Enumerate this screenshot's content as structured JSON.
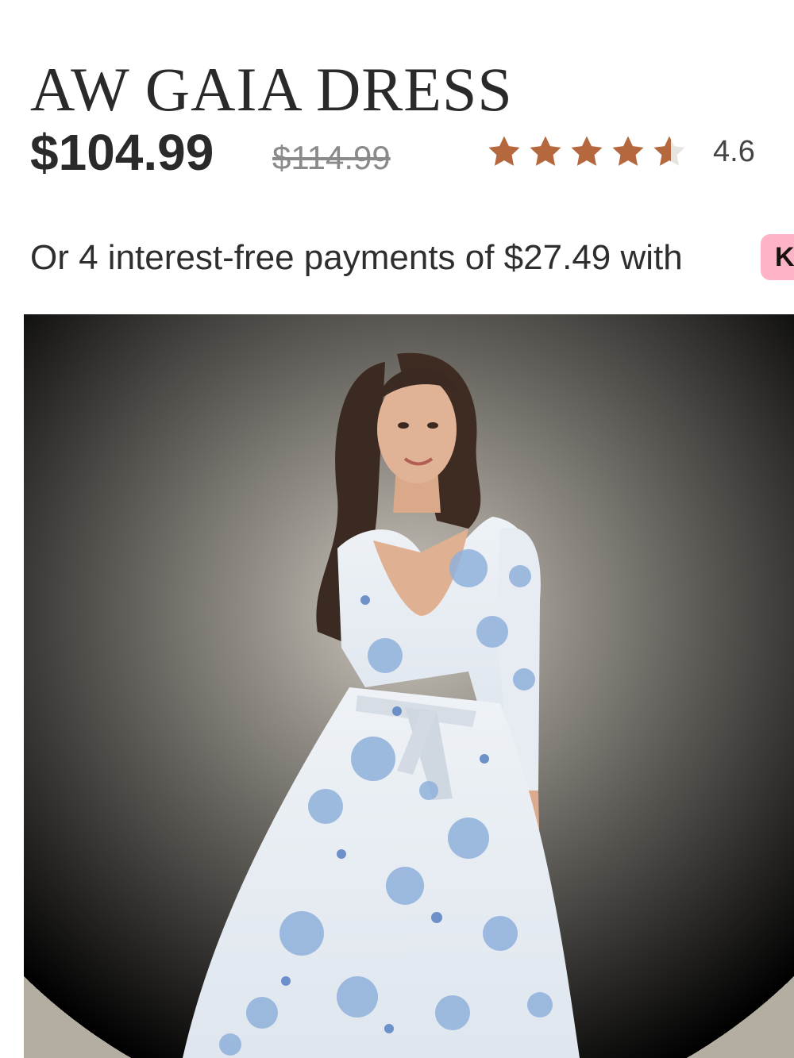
{
  "product": {
    "title": "AW GAIA DRESS",
    "price_current": "$104.99",
    "price_original": "$114.99",
    "rating_value": "4.6",
    "rating_stars": 4.6,
    "accent_color": "#b5673d"
  },
  "payment": {
    "installments_text": "Or 4 interest-free payments of $27.49 with",
    "provider_badge": "K",
    "badge_color": "#ffb3c7"
  },
  "image": {
    "icon": "product-photo"
  }
}
